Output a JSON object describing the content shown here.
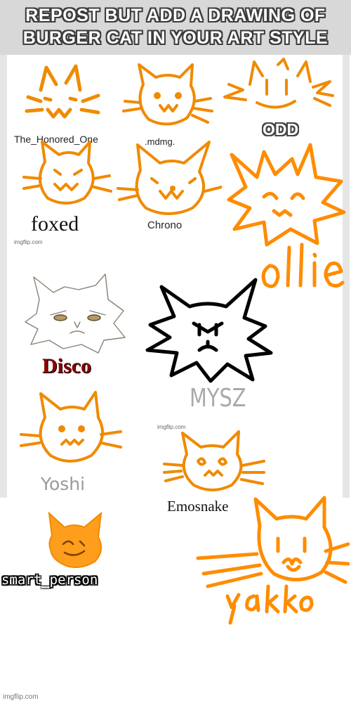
{
  "title": "REPOST BUT ADD A DRAWING OF BURGER CAT IN YOUR ART STYLE",
  "artists": {
    "honored_one": "The_Honored_One",
    "mdmg": ".mdmg.",
    "odd": "ODD",
    "foxed": "foxed",
    "chrono": "Chrono",
    "disco": "Disco",
    "mysz": "MYSZ",
    "yoshi": "Yoshi",
    "emosnake": "Emosnake",
    "smart_person": "smart_person"
  },
  "handwritten": {
    "ollie": "ollie",
    "yakko": "yakko"
  },
  "watermarks": {
    "small_1": "imgflip.com",
    "small_2": "imgflip.com",
    "footer": "imgflip.com"
  },
  "colors": {
    "sketch_orange": "#f08a00",
    "bright_orange": "#ff8c00",
    "disco_red": "#8b0000",
    "header_gray": "#d8d8d8"
  }
}
